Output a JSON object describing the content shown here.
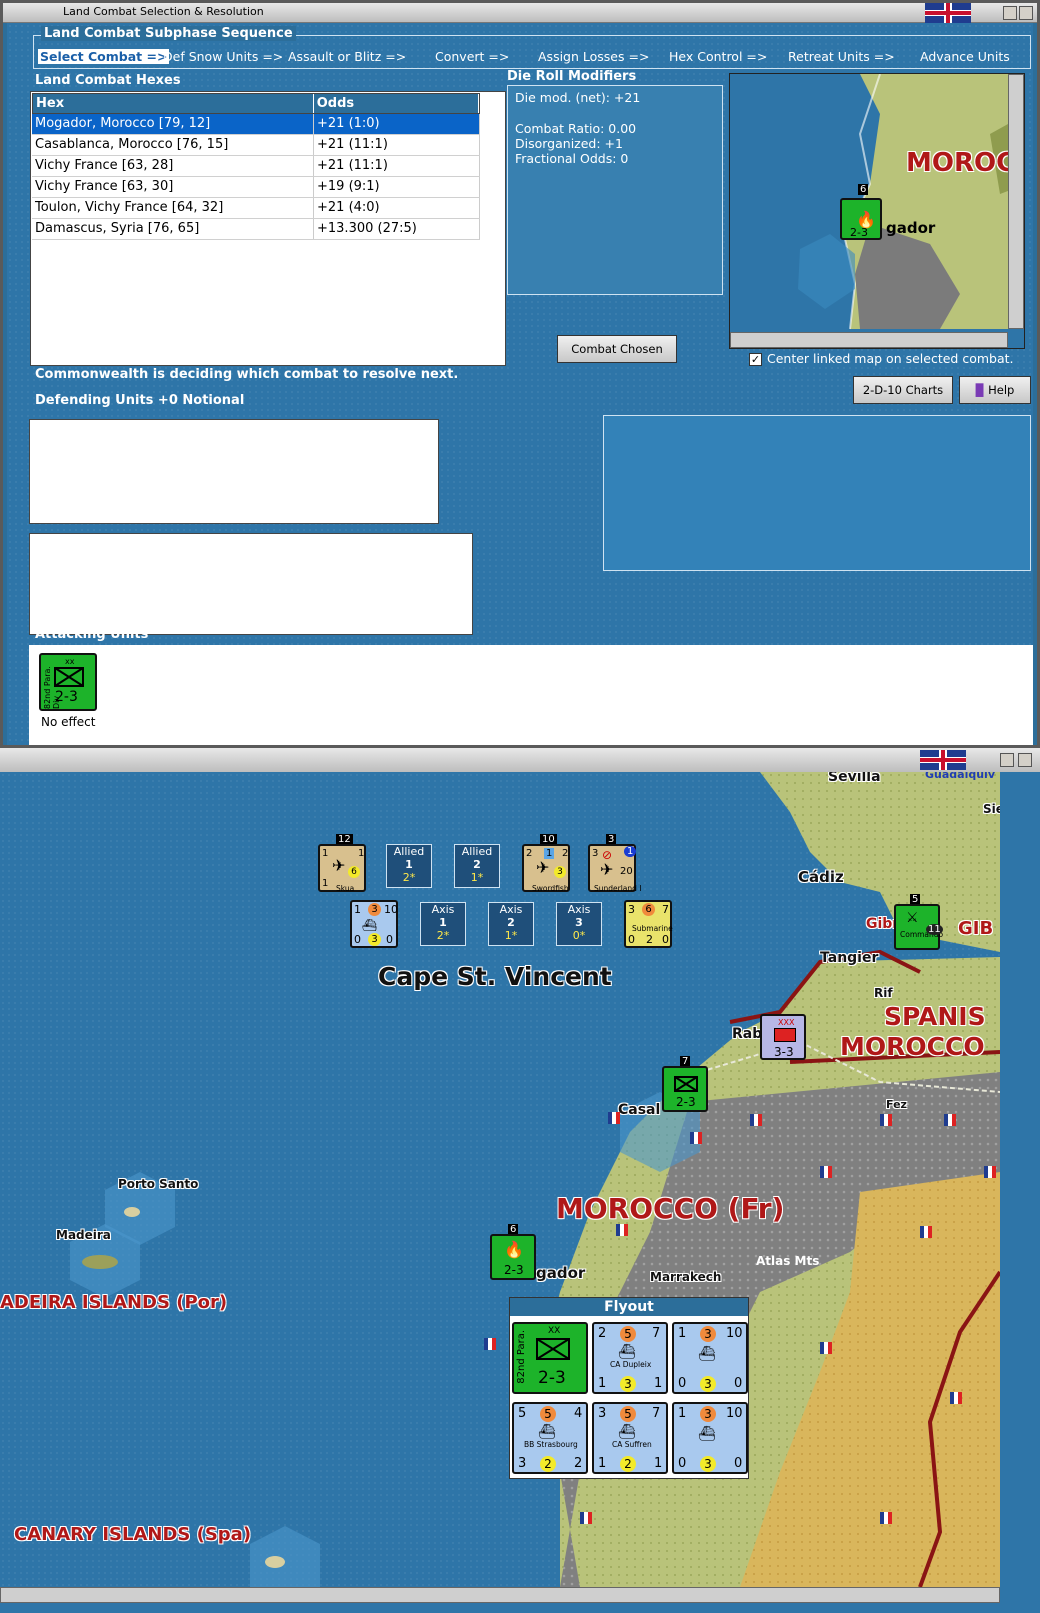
{
  "dialog": {
    "title": "Land Combat Selection & Resolution",
    "sequence_label": "Land Combat Subphase Sequence",
    "sequence": [
      "Select Combat =>",
      "Def Snow Units =>",
      "Assault or Blitz =>",
      "Convert =>",
      "Assign Losses =>",
      "Hex Control =>",
      "Retreat Units =>",
      "Advance Units"
    ],
    "hexes_label": "Land Combat Hexes",
    "table_headers": [
      "Hex",
      "Odds"
    ],
    "rows": [
      {
        "hex": "Mogador, Morocco [79, 12]",
        "odds": "+21 (1:0)"
      },
      {
        "hex": "Casablanca, Morocco [76, 15]",
        "odds": "+21 (11:1)"
      },
      {
        "hex": "Vichy France [63, 28]",
        "odds": "+21 (11:1)"
      },
      {
        "hex": "Vichy France [63, 30]",
        "odds": "+19 (9:1)"
      },
      {
        "hex": "Toulon, Vichy France [64, 32]",
        "odds": "+21 (4:0)"
      },
      {
        "hex": "Damascus, Syria [76, 65]",
        "odds": "+13.300 (27:5)"
      }
    ],
    "die_label": "Die Roll Modifiers",
    "die_lines": [
      "Die mod. (net): +21",
      "",
      "Combat Ratio: 0.00",
      "Disorganized: +1",
      "Fractional Odds: 0"
    ],
    "combat_chosen": "Combat Chosen",
    "center_label": "Center linked map on selected combat.",
    "charts_btn": "2-D-10 Charts",
    "help_btn": "Help",
    "status_text": "Commonwealth is deciding which combat to resolve next.",
    "defending_label": "Defending Units +0 Notional",
    "attacking_label": "Attacking Units",
    "attacker_counter": {
      "corner": "xx",
      "strength": "2-3",
      "side": "82nd Para. Div"
    },
    "attacker_result": "No effect",
    "minimap_label": "MOROC",
    "minimap_town": "gador",
    "minimap_counter": {
      "stack": "6",
      "strength": "2-3"
    }
  },
  "map": {
    "labels": {
      "cape": "Cape St. Vincent",
      "seville": "Sevilla",
      "guad": "Guadalquiv",
      "cadiz": "Cádiz",
      "tangier": "Tangier",
      "rif": "Rif",
      "gib": "GIB",
      "gib_red": "Gibr",
      "spanish1": "SPANIS",
      "spanish2": "MOROCCO",
      "rab": "Rab",
      "casa": "Casal",
      "fez": "Fez",
      "morocco": "MOROCCO (Fr)",
      "mogador": "gador",
      "marrakech": "Marrakech",
      "atlas": "Atlas Mts",
      "porto": "Porto Santo",
      "madeira": "Madeira",
      "madeira_isl": "ADEIRA ISLANDS (Por)",
      "canary": "CANARY ISLANDS (Spa)",
      "sie": "Sie"
    },
    "sea_boxes": [
      {
        "line1": "Allied",
        "line2": "1",
        "line3": "2*"
      },
      {
        "line1": "Allied",
        "line2": "2",
        "line3": "1*"
      },
      {
        "line1": "Axis",
        "line2": "1",
        "line3": "2*"
      },
      {
        "line1": "Axis",
        "line2": "2",
        "line3": "1*"
      },
      {
        "line1": "Axis",
        "line2": "3",
        "line3": "0*"
      }
    ],
    "counters": {
      "skua": {
        "stack": "12",
        "a": "1",
        "b": "1",
        "c": "6",
        "d": "1",
        "name": "Skua"
      },
      "swordfish": {
        "stack": "10",
        "a": "2",
        "b": "1",
        "c": "2",
        "d": "3",
        "name": "Swordfish"
      },
      "sunderland": {
        "stack": "3",
        "a": "3",
        "b": "1",
        "c": "20",
        "name": "Sunderland I"
      },
      "transport": {
        "a": "1",
        "b": "3",
        "c": "10",
        "d": "0",
        "e": "3",
        "f": "0"
      },
      "submarine": {
        "a": "3",
        "b": "6",
        "c": "7",
        "d": "0",
        "e": "2",
        "f": "0",
        "name": "Submarine"
      },
      "gib_unit": {
        "stack": "5",
        "val": "11",
        "name": "Commando"
      },
      "spanish_unit": {
        "top": "XXX",
        "strength": "3-3"
      },
      "casa_unit": {
        "stack": "7",
        "strength": "2-3"
      },
      "mogador_unit": {
        "stack": "6",
        "strength": "2-3"
      }
    },
    "flyout": {
      "title": "Flyout",
      "para": {
        "top": "XX",
        "side": "82nd Para.",
        "strength": "2-3"
      },
      "ships": [
        {
          "a": "2",
          "b": "5",
          "c": "7",
          "d": "1",
          "e": "3",
          "f": "1",
          "name": "CA Dupleix"
        },
        {
          "a": "1",
          "b": "3",
          "c": "10",
          "d": "0",
          "e": "3",
          "f": "0",
          "name": ""
        },
        {
          "a": "5",
          "b": "5",
          "c": "4",
          "d": "3",
          "e": "2",
          "f": "2",
          "name": "BB Strasbourg"
        },
        {
          "a": "3",
          "b": "5",
          "c": "7",
          "d": "1",
          "e": "2",
          "f": "1",
          "name": "CA Suffren"
        },
        {
          "a": "1",
          "b": "3",
          "c": "10",
          "d": "0",
          "e": "3",
          "f": "0",
          "name": ""
        }
      ]
    }
  }
}
